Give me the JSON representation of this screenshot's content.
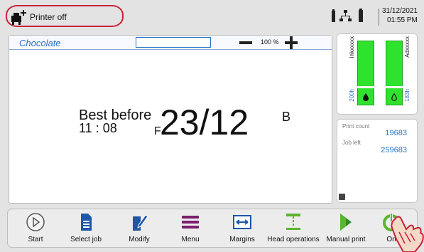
{
  "status": {
    "printer_state": "Printer off",
    "date": "31/12/2021",
    "time": "01:55 PM"
  },
  "editor": {
    "job_name": "Chocolate",
    "zoom": "100 %",
    "message": {
      "best_before": "Best before",
      "time": "11 : 08",
      "date": "23/12",
      "b_marker": "B",
      "f_marker": "F"
    }
  },
  "ink": {
    "ink_name": "Inkxxxxx",
    "ink_level": "200h",
    "additive_name": "Adxxxxx",
    "additive_level": "183h",
    "ink_color": "#2ee22e"
  },
  "counts": {
    "print_count_label": "Print count",
    "print_count": "19683",
    "job_left_label": "Job left",
    "job_left": "259683"
  },
  "toolbar": {
    "start": "Start",
    "select_job": "Select job",
    "modify": "Modify",
    "menu": "Menu",
    "margins": "Margins",
    "head_operations": "Head operations",
    "manual_print": "Manual print",
    "on": "On"
  },
  "colors": {
    "accent_blue": "#2a72c8",
    "highlight_red": "#c8223a",
    "menu_purple": "#7a1f6e",
    "ok_green": "#5bb52e"
  }
}
